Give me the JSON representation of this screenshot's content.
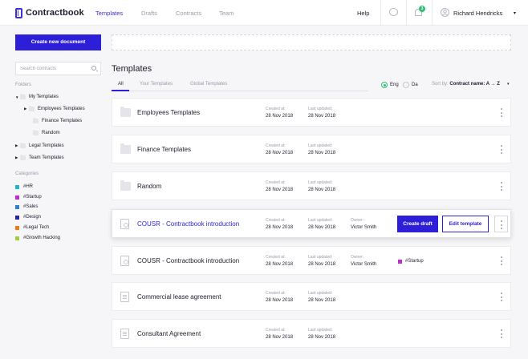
{
  "brand": {
    "name": "Contractbook",
    "color": "#3b2fd6"
  },
  "nav": {
    "items": [
      {
        "label": "Templates",
        "active": true
      },
      {
        "label": "Drafts",
        "active": false
      },
      {
        "label": "Contracts",
        "active": false
      },
      {
        "label": "Team",
        "active": false
      }
    ],
    "help": "Help",
    "notifications_count": "3",
    "user_name": "Richard Hendricks"
  },
  "sidebar": {
    "create_button": "Create new document",
    "search_placeholder": "Search contracts",
    "folders_heading": "Folders",
    "folders": [
      {
        "label": "My Templates",
        "expanded": true,
        "level": 0
      },
      {
        "label": "Employees Templates",
        "expanded": false,
        "level": 1
      },
      {
        "label": "Finance Templates",
        "level": 2
      },
      {
        "label": "Random",
        "level": 2
      },
      {
        "label": "Legal Templates",
        "expanded": false,
        "level": 0
      },
      {
        "label": "Team Templates",
        "expanded": false,
        "level": 0
      }
    ],
    "categories_heading": "Categories",
    "categories": [
      {
        "label": "#HR",
        "color": "#1fb6c9"
      },
      {
        "label": "#Startup",
        "color": "#c12bd1"
      },
      {
        "label": "#Sales",
        "color": "#2e7fd6"
      },
      {
        "label": "#Design",
        "color": "#2d1fa6"
      },
      {
        "label": "#Legal Tech",
        "color": "#f07a1a"
      },
      {
        "label": "#Growth Hacking",
        "color": "#9bd13a"
      }
    ]
  },
  "main": {
    "title": "Templates",
    "tabs": [
      {
        "label": "All",
        "active": true
      },
      {
        "label": "Your Templates",
        "active": false
      },
      {
        "label": "Global Templates",
        "active": false
      }
    ],
    "languages": [
      {
        "label": "Eng",
        "selected": true
      },
      {
        "label": "Da",
        "selected": false
      }
    ],
    "sort_label": "Sort by:",
    "sort_value": "Contract name: A → Z",
    "labels": {
      "created": "Created at:",
      "updated": "Last updated:",
      "owner": "Owner:"
    },
    "rows": [
      {
        "type": "folder",
        "title": "Employees Templates",
        "created": "28 Nov 2018",
        "updated": "28 Nov 2018"
      },
      {
        "type": "folder",
        "title": "Finance Templates",
        "created": "28 Nov 2018",
        "updated": "28 Nov 2018"
      },
      {
        "type": "folder",
        "title": "Random",
        "created": "28 Nov 2018",
        "updated": "28 Nov 2018"
      },
      {
        "type": "template-hover",
        "title": "COUSR - Contractbook introduction",
        "created": "28 Nov 2018",
        "updated": "28 Nov 2018",
        "owner": "Victor Smith",
        "primary_action": "Create draft",
        "secondary_action": "Edit template"
      },
      {
        "type": "template",
        "title": "COUSR - Contractbook introduction",
        "created": "28 Nov 2018",
        "updated": "28 Nov 2018",
        "owner": "Victor Smith",
        "tag": "#Startup",
        "tag_color": "#c12bd1"
      },
      {
        "type": "doc",
        "title": "Commercial lease agreement",
        "created": "28 Nov 2018",
        "updated": "28 Nov 2018"
      },
      {
        "type": "doc",
        "title": "Consultant Agreement",
        "created": "28 Nov 2018",
        "updated": "28 Nov 2018"
      }
    ]
  }
}
